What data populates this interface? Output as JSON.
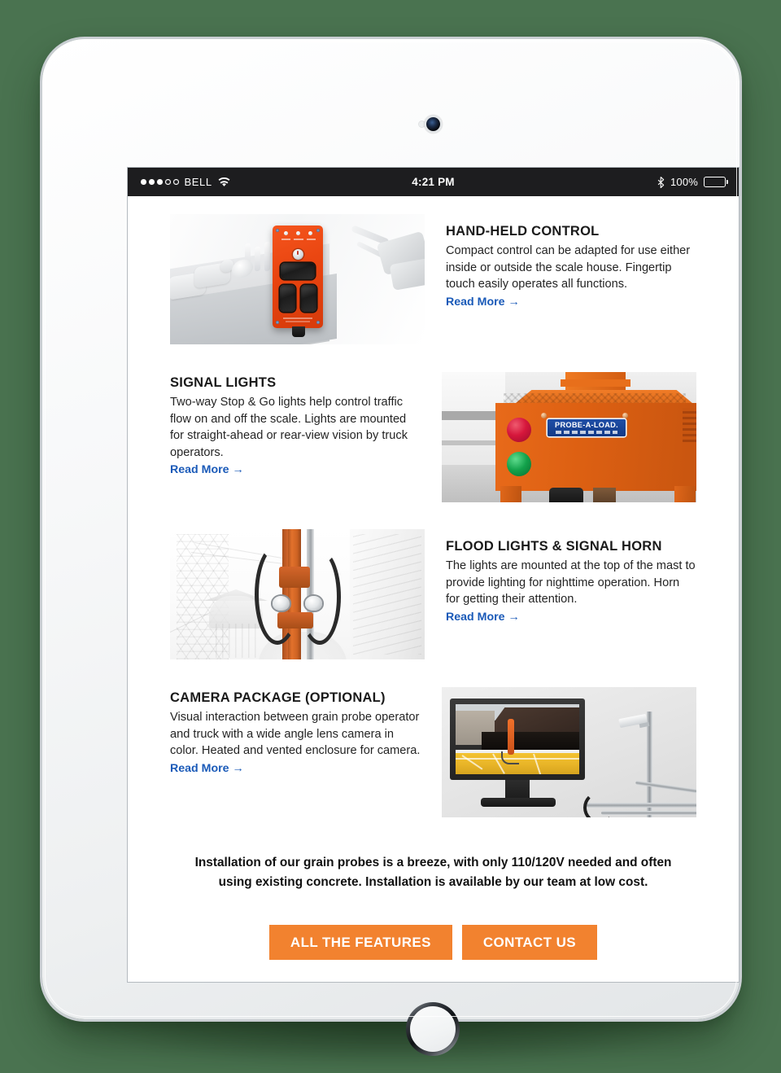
{
  "status_bar": {
    "carrier": "BELL",
    "signal_filled": 3,
    "signal_total": 5,
    "wifi_icon": "wifi-icon",
    "time": "4:21 PM",
    "bluetooth_icon": "bluetooth-icon",
    "battery_percent": "100%",
    "battery_icon": "battery-full-icon"
  },
  "features": [
    {
      "id": "hand-held-control",
      "title": "HAND-HELD CONTROL",
      "body": "Compact control can be adapted for use either inside or outside the scale house. Fingertip touch easily operates all functions.",
      "link_label": "Read More",
      "link_arrow": "→",
      "image_alt": "Orange hand-held remote control with black rocker switches on a desk",
      "image_side": "left"
    },
    {
      "id": "signal-lights",
      "title": "SIGNAL LIGHTS",
      "body": "Two-way Stop & Go lights help control traffic flow on and off the scale. Lights are mounted for straight-ahead or rear-view vision by truck operators.",
      "link_label": "Read More",
      "link_arrow": "→",
      "image_alt": "Orange housing with red and green signal lights and a PROBE-A-LOAD badge",
      "image_side": "right",
      "badge_text": "PROBE-A-LOAD."
    },
    {
      "id": "flood-lights-signal-horn",
      "title": "FLOOD LIGHTS & SIGNAL HORN",
      "body": "The lights are mounted at the top of the mast to provide lighting for nighttime operation. Horn for getting their attention.",
      "link_label": "Read More",
      "link_arrow": "→",
      "image_alt": "Orange probe mast with flood lights and hydraulic hoses",
      "image_side": "left"
    },
    {
      "id": "camera-package-optional",
      "title": "CAMERA PACKAGE (OPTIONAL)",
      "body": "Visual interaction between grain probe operator and truck with a wide angle lens camera in color. Heated and vented enclosure for camera.",
      "link_label": "Read More",
      "link_arrow": "→",
      "image_alt": "Monitor showing grain truck camera view next to a pole-mounted camera",
      "image_side": "right"
    }
  ],
  "promo": {
    "text": "Installation of our grain probes is a breeze, with only 110/120V needed and often using existing concrete. Installation is available by our team at low cost."
  },
  "cta": {
    "primary_label": "ALL THE FEATURES",
    "secondary_label": "CONTACT US"
  },
  "colors": {
    "background": "#4a7350",
    "accent_orange": "#f2822f",
    "link_blue": "#1a5ab8",
    "status_bar": "#1d1d1f",
    "text": "#242424",
    "heading": "#1a1a1a",
    "badge_blue": "#1f4fa8"
  }
}
